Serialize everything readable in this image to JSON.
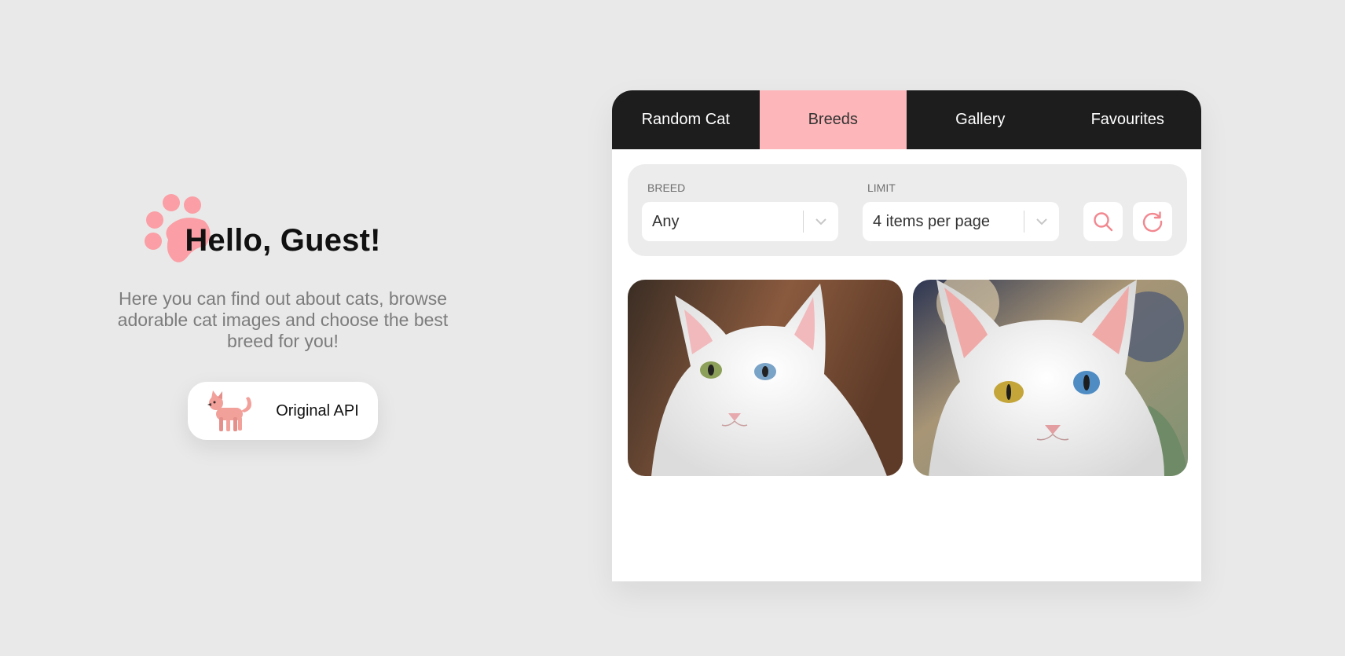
{
  "hero": {
    "title": "Hello, Guest!",
    "subtitle": "Here you can find out about cats, browse adorable cat images and choose the best breed for you!",
    "api_button_label": "Original API"
  },
  "tabs": [
    {
      "label": "Random Cat",
      "active": false
    },
    {
      "label": "Breeds",
      "active": true
    },
    {
      "label": "Gallery",
      "active": false
    },
    {
      "label": "Favourites",
      "active": false
    }
  ],
  "filters": {
    "breed_label": "BREED",
    "breed_value": "Any",
    "limit_label": "LIMIT",
    "limit_value": "4 items per page",
    "search_icon": "search-icon",
    "refresh_icon": "refresh-icon"
  },
  "images": [
    {
      "name": "white-cat-photo-1"
    },
    {
      "name": "white-cat-photo-2"
    }
  ],
  "colors": {
    "accent": "#fdb6b9",
    "paw": "#fb9ea5",
    "tab_bar": "#1d1d1d",
    "background": "#e9e9e9"
  }
}
